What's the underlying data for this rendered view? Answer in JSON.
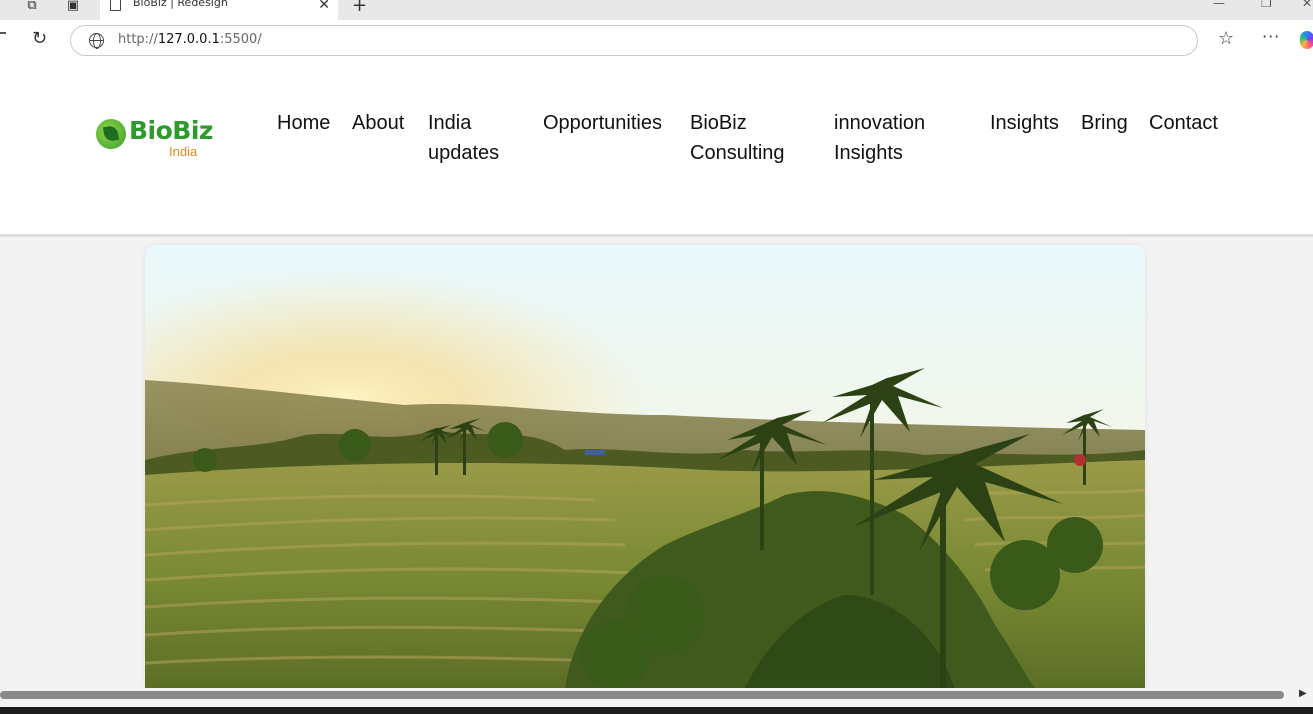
{
  "browser": {
    "tab_title": "BioBiz | Redesign",
    "url_prefix": "http://",
    "url_host": "127.0.0.1",
    "url_rest": ":5500/"
  },
  "logo": {
    "name": "BioBiz",
    "sub": "India"
  },
  "nav": {
    "items": [
      {
        "label": "Home"
      },
      {
        "label": "About"
      },
      {
        "label": "India",
        "label2": "updates"
      },
      {
        "label": "Opportunities"
      },
      {
        "label": "BioBiz",
        "label2": "Consulting"
      },
      {
        "label": "innovation",
        "label2": "Insights"
      },
      {
        "label": "Insights"
      },
      {
        "label": "Bring"
      },
      {
        "label": "Contact"
      }
    ]
  },
  "colors": {
    "brand_green": "#2f9a2c",
    "brand_orange": "#e08a1e"
  },
  "icons": {
    "reload": "reload-icon",
    "globe": "globe-icon",
    "favorites": "favorites-star-icon",
    "more": "more-icon"
  }
}
